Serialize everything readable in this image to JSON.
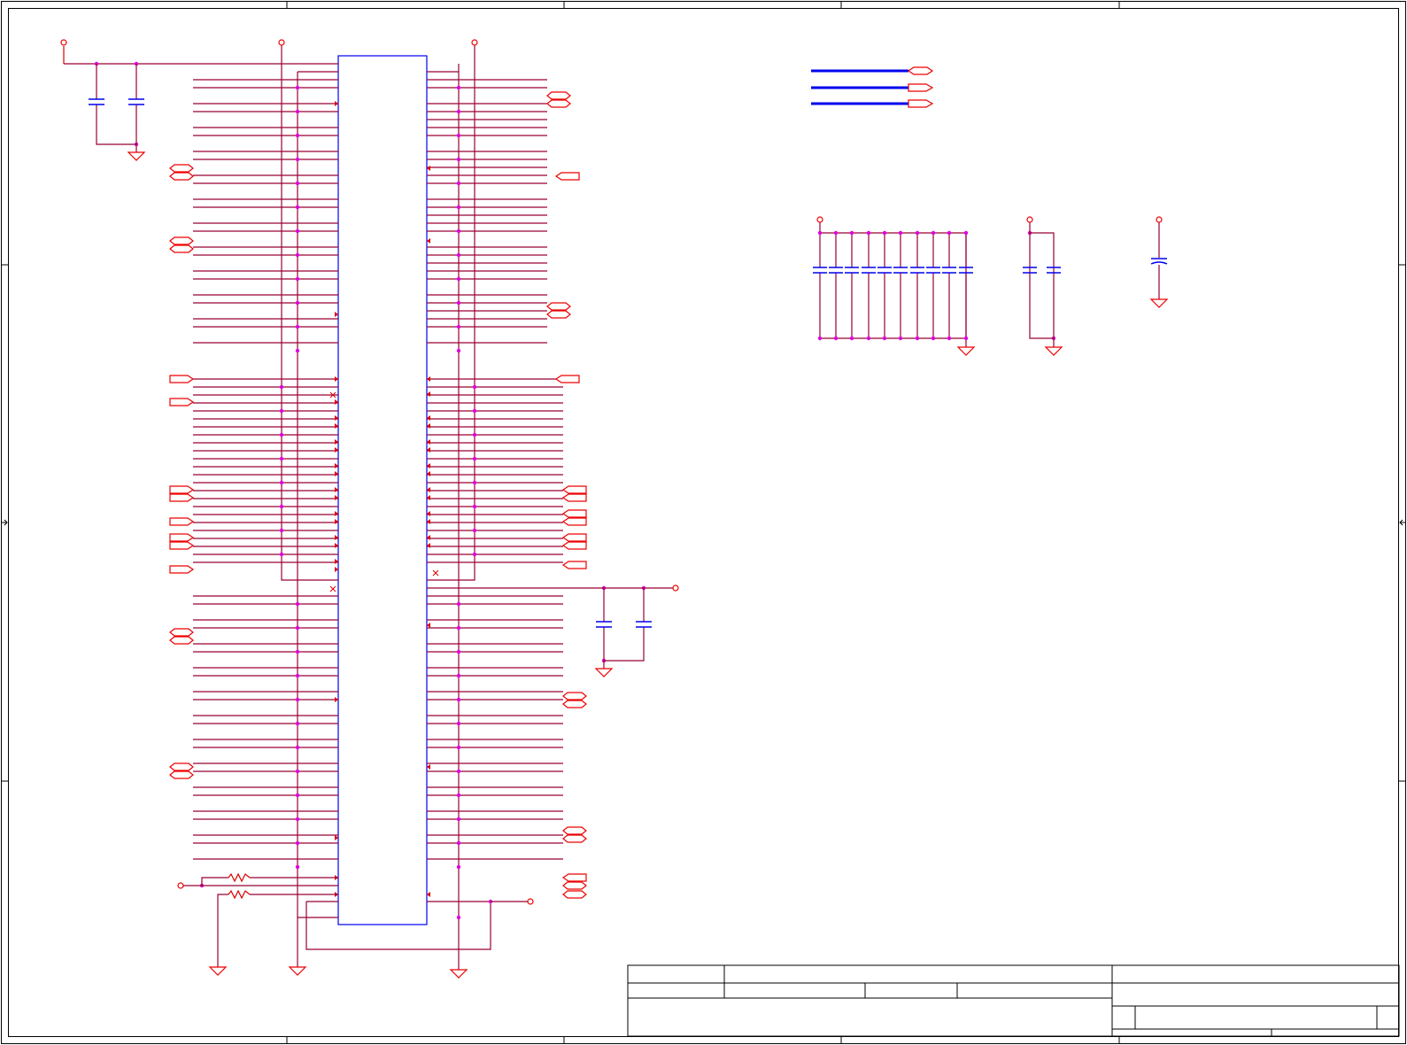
{
  "title": "",
  "colors": {
    "wire": "#990033",
    "signal": "#dd0000",
    "part_outline": "#0000ee",
    "junction": "#e000e0",
    "frame": "#000000"
  },
  "symbols": [
    "ic-body",
    "capacitor",
    "resistor",
    "ground",
    "power-port",
    "net-port",
    "junction-dot",
    "no-connect"
  ],
  "title_block": {
    "fields": [
      "",
      "",
      "",
      "",
      "",
      "",
      "",
      ""
    ]
  }
}
